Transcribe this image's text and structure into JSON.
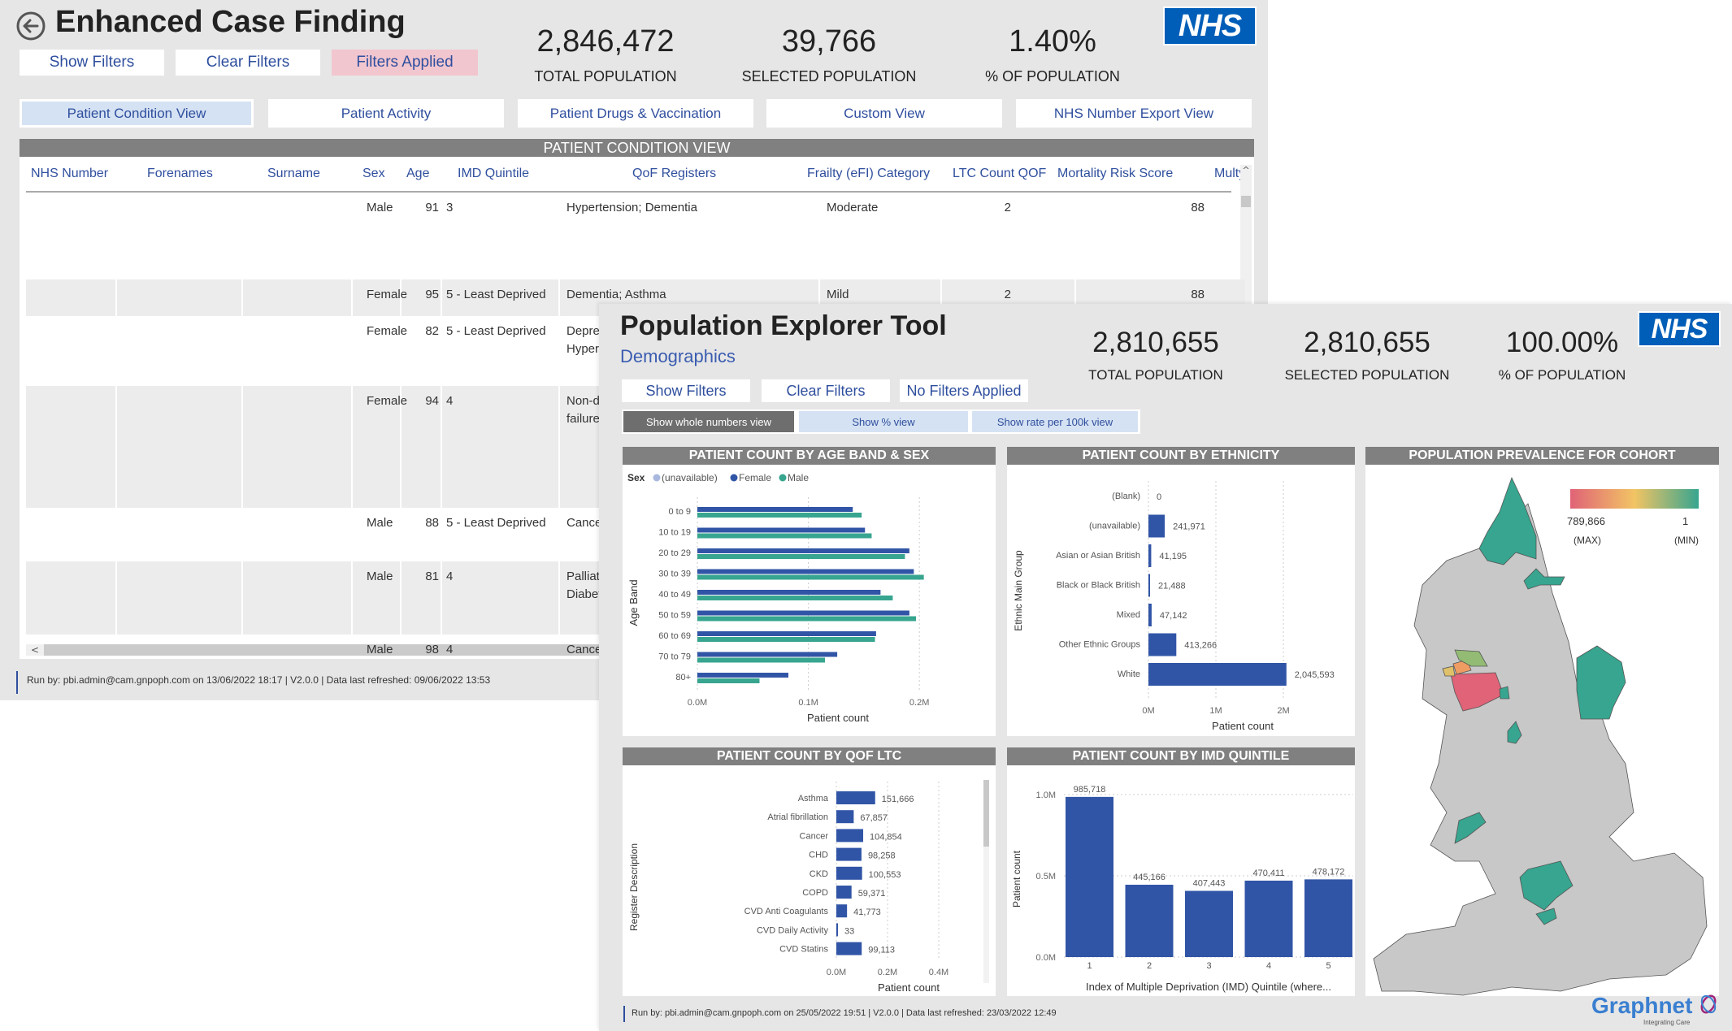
{
  "case_finding": {
    "title": "Enhanced Case Finding",
    "buttons": {
      "show_filters": "Show Filters",
      "clear_filters": "Clear Filters",
      "filters_applied": "Filters Applied"
    },
    "kpis": [
      {
        "value": "2,846,472",
        "label": "TOTAL POPULATION"
      },
      {
        "value": "39,766",
        "label": "SELECTED POPULATION"
      },
      {
        "value": "1.40%",
        "label": "% OF POPULATION"
      }
    ],
    "logo": "NHS",
    "tabs": [
      {
        "label": "Patient Condition View",
        "active": true
      },
      {
        "label": "Patient Activity",
        "active": false
      },
      {
        "label": "Patient Drugs & Vaccination",
        "active": false
      },
      {
        "label": "Custom View",
        "active": false
      },
      {
        "label": "NHS Number Export View",
        "active": false
      }
    ],
    "table": {
      "banner": "PATIENT CONDITION VIEW",
      "columns": [
        "NHS Number",
        "Forenames",
        "Surname",
        "Sex",
        "Age",
        "IMD Quintile",
        "QoF Registers",
        "Frailty (eFI) Category",
        "LTC Count QOF",
        "Mortality Risk Score",
        "Multy I"
      ],
      "rows": [
        {
          "nhs": "",
          "forenames": "",
          "surname": "",
          "sex": "Male",
          "age": "91",
          "imd": "3",
          "qof": "Hypertension; Dementia",
          "frailty": "Moderate",
          "ltc": "2",
          "mortality": "88"
        },
        {
          "nhs": "",
          "forenames": "",
          "surname": "",
          "sex": "Female",
          "age": "95",
          "imd": "5 - Least Deprived",
          "qof": "Dementia; Asthma",
          "frailty": "Mild",
          "ltc": "2",
          "mortality": "88"
        },
        {
          "nhs": "",
          "forenames": "",
          "surname": "",
          "sex": "Female",
          "age": "82",
          "imd": "5 - Least Deprived",
          "qof": "Depres\nHypert",
          "frailty": "",
          "ltc": "",
          "mortality": ""
        },
        {
          "nhs": "",
          "forenames": "",
          "surname": "",
          "sex": "Female",
          "age": "94",
          "imd": "4",
          "qof": "Non-di\nfailure;",
          "frailty": "",
          "ltc": "",
          "mortality": ""
        },
        {
          "nhs": "",
          "forenames": "",
          "surname": "",
          "sex": "Male",
          "age": "88",
          "imd": "5 - Least Deprived",
          "qof": "Cancer",
          "frailty": "",
          "ltc": "",
          "mortality": ""
        },
        {
          "nhs": "",
          "forenames": "",
          "surname": "",
          "sex": "Male",
          "age": "81",
          "imd": "4",
          "qof": "Palliati\nDiabet",
          "frailty": "",
          "ltc": "",
          "mortality": ""
        },
        {
          "nhs": "",
          "forenames": "",
          "surname": "",
          "sex": "Male",
          "age": "98",
          "imd": "4",
          "qof": "Cancer",
          "frailty": "",
          "ltc": "",
          "mortality": ""
        }
      ]
    },
    "footer": "Run by: pbi.admin@cam.gnpoph.com on 13/06/2022 18:17 | V2.0.0 | Data last refreshed: 09/06/2022 13:53"
  },
  "population_explorer": {
    "title": "Population Explorer Tool",
    "subtitle": "Demographics",
    "buttons": {
      "show_filters": "Show Filters",
      "clear_filters": "Clear Filters",
      "filter_status": "No Filters Applied"
    },
    "view_toggles": [
      {
        "label": "Show whole numbers view",
        "active": true
      },
      {
        "label": "Show % view",
        "active": false
      },
      {
        "label": "Show rate per 100k view",
        "active": false
      }
    ],
    "kpis": [
      {
        "value": "2,810,655",
        "label": "TOTAL POPULATION"
      },
      {
        "value": "2,810,655",
        "label": "SELECTED POPULATION"
      },
      {
        "value": "100.00%",
        "label": "% OF POPULATION"
      }
    ],
    "logo": "NHS",
    "footer": "Run by: pbi.admin@cam.gnpoph.com on 25/05/2022 19:51 | V2.0.0 | Data last refreshed: 23/03/2022 12:49",
    "brand": {
      "name": "Graphnet",
      "tagline": "Integrating Care"
    },
    "colors": {
      "female": "#3155a6",
      "male": "#37a58f",
      "unavailable": "#a9b8de",
      "bar": "#3155a6",
      "header": "#808080",
      "accent_text": "#2f4f9e"
    }
  },
  "chart_data": [
    {
      "type": "bar",
      "orientation": "horizontal",
      "title": "PATIENT COUNT BY AGE BAND & SEX",
      "legend_title": "Sex",
      "legend": [
        "(unavailable)",
        "Female",
        "Male"
      ],
      "legend_placement": "top-left",
      "categories": [
        "0 to 9",
        "10 to 19",
        "20 to 29",
        "30 to 39",
        "40 to 49",
        "50 to 59",
        "60 to 69",
        "70 to 79",
        "80+"
      ],
      "series": [
        {
          "name": "Female",
          "values": [
            140000,
            151000,
            191000,
            195000,
            165000,
            191000,
            161000,
            126000,
            82000
          ]
        },
        {
          "name": "Male",
          "values": [
            148000,
            157000,
            187000,
            204000,
            176000,
            197000,
            160000,
            115000,
            56000
          ]
        }
      ],
      "xlabel": "Patient count",
      "ylabel": "Age Band",
      "xticks": [
        "0.0M",
        "0.1M",
        "0.2M"
      ],
      "xlim": [
        0,
        210000
      ],
      "grid": true
    },
    {
      "type": "bar",
      "orientation": "horizontal",
      "title": "PATIENT COUNT BY ETHNICITY",
      "categories": [
        "(Blank)",
        "(unavailable)",
        "Asian or Asian British",
        "Black or Black British",
        "Mixed",
        "Other Ethnic Groups",
        "White"
      ],
      "values": [
        0,
        241971,
        41195,
        21488,
        47142,
        413266,
        2045593
      ],
      "labels": [
        "0",
        "241,971",
        "41,195",
        "21,488",
        "47,142",
        "413,266",
        "2,045,593"
      ],
      "xlabel": "Patient count",
      "ylabel": "Ethnic Main Group",
      "xticks": [
        "0M",
        "1M",
        "2M"
      ],
      "xlim": [
        0,
        2400000
      ],
      "grid": true
    },
    {
      "type": "heatmap",
      "title": "POPULATION PREVALENCE FOR COHORT",
      "legend": {
        "max_value": "789,866",
        "max_label": "(MAX)",
        "min_value": "1",
        "min_label": "(MIN)"
      },
      "color_scale": [
        "#e06377",
        "#f2c464",
        "#37a58f"
      ]
    },
    {
      "type": "bar",
      "orientation": "horizontal",
      "title": "PATIENT COUNT BY QOF LTC",
      "categories": [
        "Asthma",
        "Atrial fibrillation",
        "Cancer",
        "CHD",
        "CKD",
        "COPD",
        "CVD Anti Coagulants",
        "CVD Daily Activity",
        "CVD Statins"
      ],
      "values": [
        151666,
        67857,
        104854,
        98258,
        100553,
        59371,
        41773,
        33,
        99113
      ],
      "labels": [
        "151,666",
        "67,857",
        "104,854",
        "98,258",
        "100,553",
        "59,371",
        "41,773",
        "33",
        "99,113"
      ],
      "xlabel": "Patient count",
      "ylabel": "Register Description",
      "xticks": [
        "0.0M",
        "0.2M",
        "0.4M"
      ],
      "xlim": [
        0,
        400000
      ],
      "grid": true
    },
    {
      "type": "bar",
      "orientation": "vertical",
      "title": "PATIENT COUNT BY IMD QUINTILE",
      "categories": [
        "1",
        "2",
        "3",
        "4",
        "5"
      ],
      "values": [
        985718,
        445166,
        407443,
        470411,
        478172
      ],
      "labels": [
        "985,718",
        "445,166",
        "407,443",
        "470,411",
        "478,172"
      ],
      "xlabel": "Index of Multiple Deprivation (IMD) Quintile (where...",
      "ylabel": "Patient count",
      "yticks": [
        "0.0M",
        "0.5M",
        "1.0M"
      ],
      "ylim": [
        0,
        1000000
      ],
      "grid": true
    }
  ]
}
